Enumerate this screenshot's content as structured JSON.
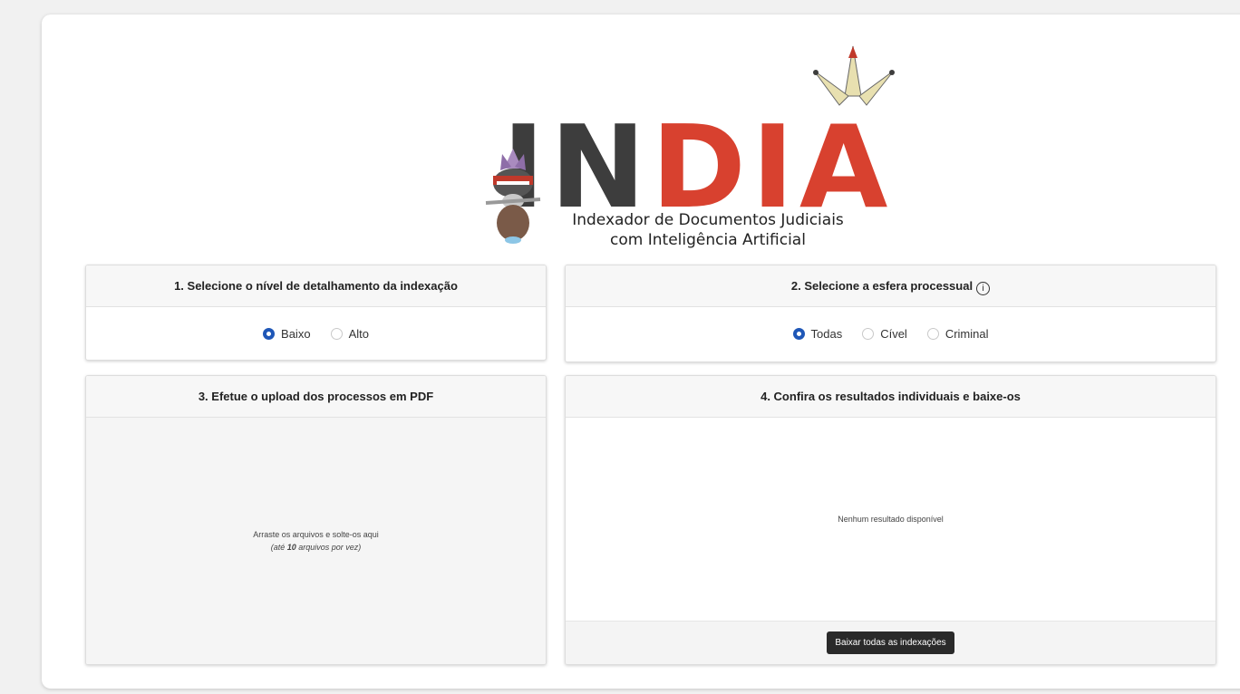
{
  "logo": {
    "letters": [
      "I",
      "N",
      "D",
      "I",
      "A"
    ],
    "tagline_line1": "Indexador de Documentos Judiciais",
    "tagline_line2": "com Inteligência Artificial",
    "colors": {
      "dark": "#3d3d3d",
      "red": "#d8412f"
    }
  },
  "section1": {
    "title": "1. Selecione o nível de detalhamento da indexação",
    "options": [
      {
        "label": "Baixo",
        "selected": true
      },
      {
        "label": "Alto",
        "selected": false
      }
    ]
  },
  "section2": {
    "title": "2. Selecione a esfera processual",
    "info_icon": "info-icon",
    "options": [
      {
        "label": "Todas",
        "selected": true
      },
      {
        "label": "Cível",
        "selected": false
      },
      {
        "label": "Criminal",
        "selected": false
      }
    ]
  },
  "section3": {
    "title": "3. Efetue o upload dos processos em PDF",
    "dropzone_text": "Arraste os arquivos e solte-os aqui",
    "dropzone_sub_prefix": "(até ",
    "dropzone_sub_count": "10",
    "dropzone_sub_suffix": " arquivos por vez)"
  },
  "section4": {
    "title": "4. Confira os resultados individuais e baixe-os",
    "empty_text": "Nenhum resultado disponível",
    "download_all_label": "Baixar todas as indexações"
  },
  "colors": {
    "accent": "#1f57b7",
    "button": "#2a2a2a"
  }
}
